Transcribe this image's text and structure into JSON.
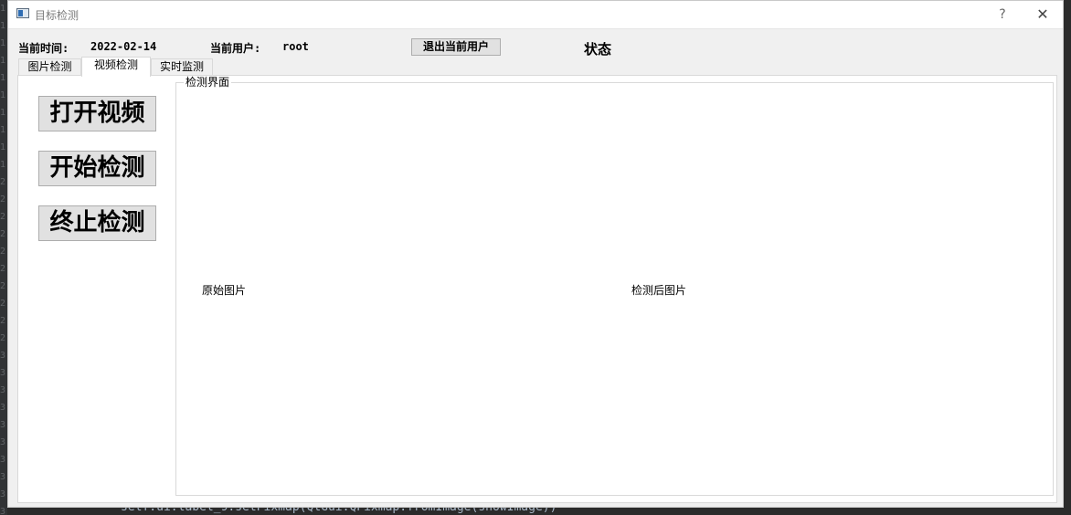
{
  "window": {
    "title": "目标检测",
    "help_glyph": "?",
    "close_glyph": "✕"
  },
  "header": {
    "time_label": "当前时间:",
    "time_value": "2022-02-14",
    "user_label": "当前用户:",
    "user_value": "root",
    "logout_button": "退出当前用户",
    "status_label": "状态"
  },
  "tabs": [
    {
      "label": "图片检测",
      "active": false
    },
    {
      "label": "视频检测",
      "active": true
    },
    {
      "label": "实时监测",
      "active": false
    }
  ],
  "actions": {
    "open_video": "打开视频",
    "start_detect": "开始检测",
    "stop_detect": "终止检测"
  },
  "detection_panel": {
    "title": "检测界面",
    "original_label": "原始图片",
    "result_label": "检测后图片"
  },
  "background_editor": {
    "code_line": "self.ui.label_9.setPixmap(QtGui.QPixmap.fromImage(showImage))"
  }
}
